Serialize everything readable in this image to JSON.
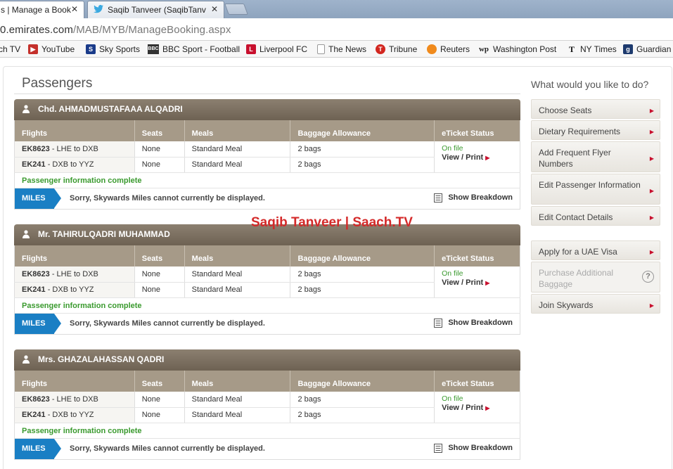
{
  "browser": {
    "tabs": [
      {
        "label": "s | Manage a Book",
        "close": "✕"
      },
      {
        "label": "Saqib Tanveer (SaqibTanv",
        "close": "✕"
      }
    ],
    "url_domain": "0.emirates.com",
    "url_path": "/MAB/MYB/ManageBooking.aspx",
    "bookmarks": [
      {
        "label": "ch TV"
      },
      {
        "label": "YouTube"
      },
      {
        "label": "Sky Sports"
      },
      {
        "label": "BBC Sport - Football"
      },
      {
        "label": "Liverpool FC"
      },
      {
        "label": "The News"
      },
      {
        "label": "Tribune"
      },
      {
        "label": "Reuters"
      },
      {
        "label": "Washington Post"
      },
      {
        "label": "NY Times"
      },
      {
        "label": "Guardian"
      }
    ]
  },
  "page": {
    "title": "Passengers",
    "watermark": "Saqib Tanveer | Saach.TV",
    "columns": [
      "Flights",
      "Seats",
      "Meals",
      "Baggage Allowance",
      "eTicket Status"
    ],
    "passengers": [
      {
        "name": "Chd. AHMADMUSTAFAAA ALQADRI",
        "flights": [
          {
            "code": "EK8623",
            "route": " - LHE to DXB",
            "seat": "None",
            "meal": "Standard Meal",
            "bags": "2 bags"
          },
          {
            "code": "EK241",
            "route": " - DXB to YYZ",
            "seat": "None",
            "meal": "Standard Meal",
            "bags": "2 bags"
          }
        ],
        "eticket_status": "On file",
        "eticket_action": "View / Print",
        "complete_text": "Passenger information complete",
        "miles_label": "MILES",
        "miles_message": "Sorry, Skywards Miles cannot currently be displayed.",
        "breakdown_label": "Show Breakdown"
      },
      {
        "name": "Mr. TAHIRULQADRI MUHAMMAD",
        "flights": [
          {
            "code": "EK8623",
            "route": " - LHE to DXB",
            "seat": "None",
            "meal": "Standard Meal",
            "bags": "2 bags"
          },
          {
            "code": "EK241",
            "route": " - DXB to YYZ",
            "seat": "None",
            "meal": "Standard Meal",
            "bags": "2 bags"
          }
        ],
        "eticket_status": "On file",
        "eticket_action": "View / Print",
        "complete_text": "Passenger information complete",
        "miles_label": "MILES",
        "miles_message": "Sorry, Skywards Miles cannot currently be displayed.",
        "breakdown_label": "Show Breakdown"
      },
      {
        "name": "Mrs. GHAZALAHASSAN QADRI",
        "flights": [
          {
            "code": "EK8623",
            "route": " - LHE to DXB",
            "seat": "None",
            "meal": "Standard Meal",
            "bags": "2 bags"
          },
          {
            "code": "EK241",
            "route": " - DXB to YYZ",
            "seat": "None",
            "meal": "Standard Meal",
            "bags": "2 bags"
          }
        ],
        "eticket_status": "On file",
        "eticket_action": "View / Print",
        "complete_text": "Passenger information complete",
        "miles_label": "MILES",
        "miles_message": "Sorry, Skywards Miles cannot currently be displayed.",
        "breakdown_label": "Show Breakdown"
      }
    ]
  },
  "sidebar": {
    "title": "What would you like to do?",
    "actions": [
      {
        "label": "Choose Seats"
      },
      {
        "label": "Dietary Requirements"
      },
      {
        "label": "Add Frequent Flyer Numbers"
      },
      {
        "label": "Edit Passenger Information"
      },
      {
        "label": "Edit Contact Details"
      },
      {
        "label": "Apply for a UAE Visa"
      },
      {
        "label": "Purchase Additional Baggage",
        "help": "?"
      },
      {
        "label": "Join Skywards"
      }
    ]
  },
  "colors": {
    "header_brown": "#6e6253",
    "column_tan": "#a69a88",
    "miles_blue": "#1a7fc4",
    "accent_red": "#c8102e",
    "status_green": "#3a9a2e"
  }
}
